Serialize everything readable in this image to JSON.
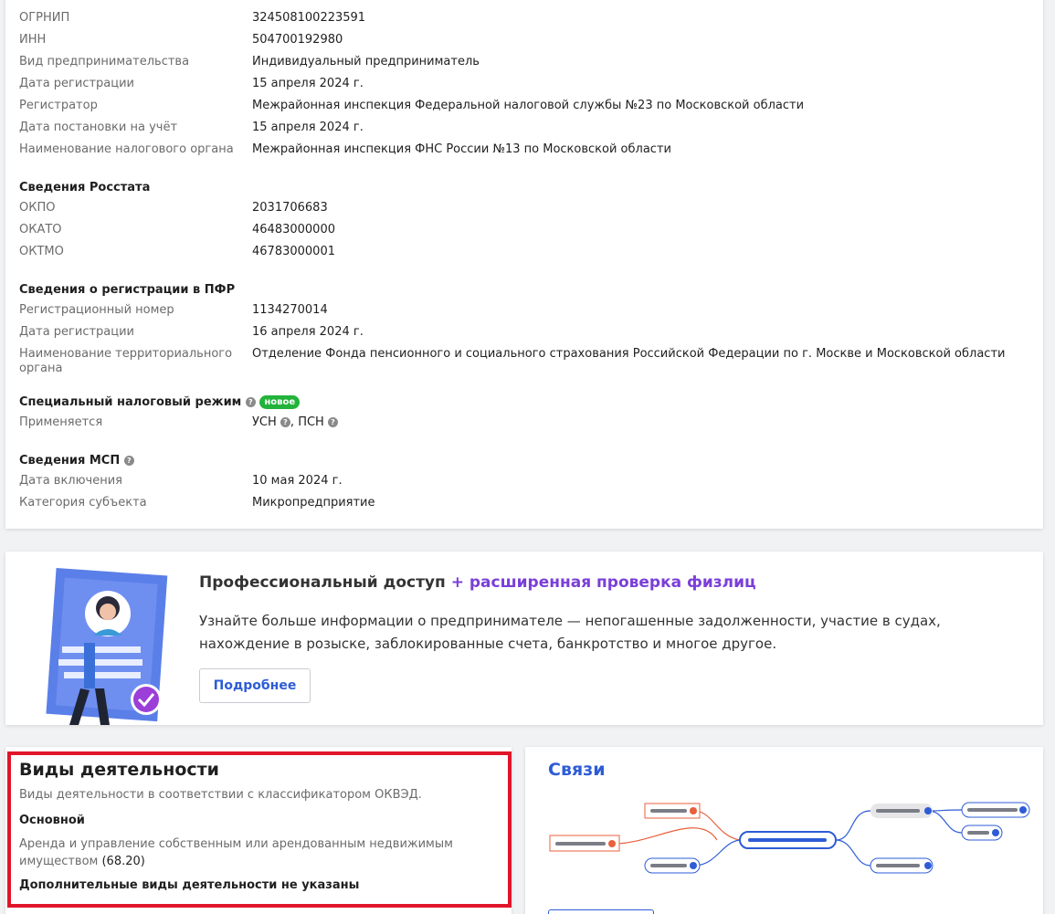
{
  "requisites": {
    "rows": [
      {
        "label": "ОГРНИП",
        "value": "324508100223591"
      },
      {
        "label": "ИНН",
        "value": "504700192980"
      },
      {
        "label": "Вид предпринимательства",
        "value": "Индивидуальный предприниматель"
      },
      {
        "label": "Дата регистрации",
        "value": "15 апреля 2024 г."
      },
      {
        "label": "Регистратор",
        "value": "Межрайонная инспекция Федеральной налоговой службы №23 по Московской области"
      },
      {
        "label": "Дата постановки на учёт",
        "value": "15 апреля 2024 г."
      },
      {
        "label": "Наименование налогового органа",
        "value": "Межрайонная инспекция ФНС России №13 по Московской области"
      }
    ]
  },
  "rosstat": {
    "title": "Сведения Росстата",
    "rows": [
      {
        "label": "ОКПО",
        "value": "2031706683"
      },
      {
        "label": "ОКАТО",
        "value": "46483000000"
      },
      {
        "label": "ОКТМО",
        "value": "46783000001"
      }
    ]
  },
  "pfr": {
    "title": "Сведения о регистрации в ПФР",
    "rows": [
      {
        "label": "Регистрационный номер",
        "value": "1134270014"
      },
      {
        "label": "Дата регистрации",
        "value": "16 апреля 2024 г."
      },
      {
        "label": "Наименование территориального органа",
        "value": "Отделение Фонда пенсионного и социального страхования Российской Федерации по г. Москве и Московской области"
      }
    ]
  },
  "tax_regime": {
    "title": "Специальный налоговый режим",
    "badge": "новое",
    "label": "Применяется",
    "value_1": "УСН",
    "sep": ",",
    "value_2": "ПСН"
  },
  "msp": {
    "title": "Сведения МСП",
    "rows": [
      {
        "label": "Дата включения",
        "value": "10 мая 2024 г."
      },
      {
        "label": "Категория субъекта",
        "value": "Микропредприятие"
      }
    ]
  },
  "promo": {
    "title": "Профессиональный доступ",
    "title_accent": "+ расширенная проверка физлиц",
    "text": "Узнайте больше информации о предпринимателе — непогашенные задолженности, участие в судах, нахождение в розыске, заблокированные счета, банкротство и многое другое.",
    "button": "Подробнее"
  },
  "okved": {
    "title": "Виды деятельности",
    "subtitle": "Виды деятельности в соответствии с классификатором ОКВЭД.",
    "main_heading": "Основной",
    "main_text": "Аренда и управление собственным или арендованным недвижимым имуществом",
    "main_code": "(68.20)",
    "extra": "Дополнительные виды деятельности не указаны"
  },
  "links": {
    "title": "Связи"
  },
  "colors": {
    "accent_blue": "#2e5cd6",
    "accent_purple": "#7a3fd8",
    "badge_green": "#22b33a",
    "highlight_red": "#e0152a",
    "node_red": "#e8603c"
  }
}
